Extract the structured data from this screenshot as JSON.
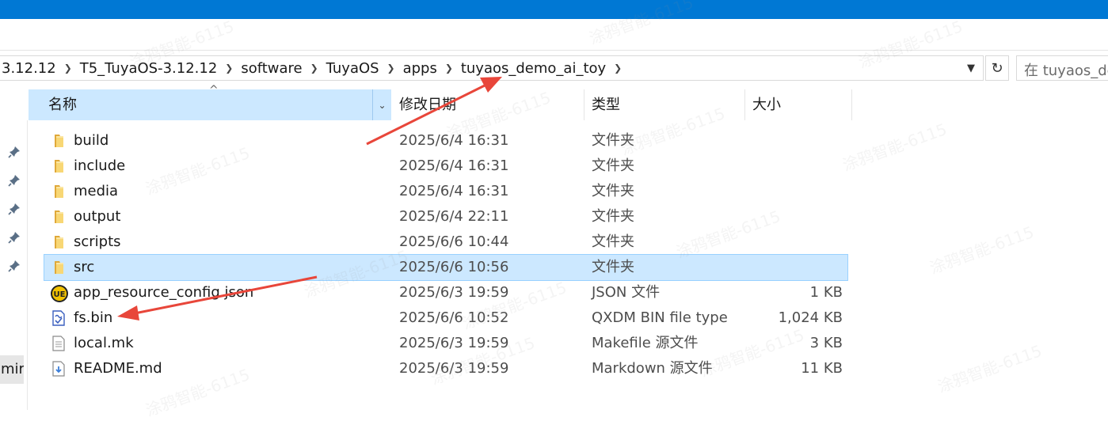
{
  "window": {
    "titlebar_color": "#0078d4"
  },
  "address_bar": {
    "crumbs": [
      "3.12.12",
      "T5_TuyaOS-3.12.12",
      "software",
      "TuyaOS",
      "apps",
      "tuyaos_demo_ai_toy"
    ],
    "dropdown_icon": "chevron-down-icon",
    "refresh_icon": "refresh-icon"
  },
  "search": {
    "placeholder": "在 tuyaos_demo_ai_toy 中搜索"
  },
  "columns": {
    "name": "名称",
    "date": "修改日期",
    "type": "类型",
    "size": "大小"
  },
  "files": [
    {
      "name": "build",
      "date": "2025/6/4 16:31",
      "type": "文件夹",
      "size": "",
      "icon": "folder-icon"
    },
    {
      "name": "include",
      "date": "2025/6/4 16:31",
      "type": "文件夹",
      "size": "",
      "icon": "folder-icon"
    },
    {
      "name": "media",
      "date": "2025/6/4 16:31",
      "type": "文件夹",
      "size": "",
      "icon": "folder-icon"
    },
    {
      "name": "output",
      "date": "2025/6/4 22:11",
      "type": "文件夹",
      "size": "",
      "icon": "folder-icon"
    },
    {
      "name": "scripts",
      "date": "2025/6/6 10:44",
      "type": "文件夹",
      "size": "",
      "icon": "folder-icon"
    },
    {
      "name": "src",
      "date": "2025/6/6 10:56",
      "type": "文件夹",
      "size": "",
      "icon": "folder-icon",
      "selected": true
    },
    {
      "name": "app_resource_config.json",
      "date": "2025/6/3 19:59",
      "type": "JSON 文件",
      "size": "1 KB",
      "icon": "ue-json-icon"
    },
    {
      "name": "fs.bin",
      "date": "2025/6/6 10:52",
      "type": "QXDM BIN file type",
      "size": "1,024 KB",
      "icon": "bin-file-icon"
    },
    {
      "name": "local.mk",
      "date": "2025/6/3 19:59",
      "type": "Makefile 源文件",
      "size": "3 KB",
      "icon": "text-file-icon"
    },
    {
      "name": "README.md",
      "date": "2025/6/3 19:59",
      "type": "Markdown 源文件",
      "size": "11 KB",
      "icon": "markdown-file-icon"
    }
  ],
  "nav_pane": {
    "partial_label": "mir",
    "pin_icon": "pin-icon",
    "pin_count": 5
  },
  "watermark": {
    "text": "涂鸦智能-6115"
  },
  "annotation": {
    "arrow_color": "#e8463a"
  },
  "colors": {
    "selection": "#cce8ff",
    "folder": "#f8d775"
  }
}
